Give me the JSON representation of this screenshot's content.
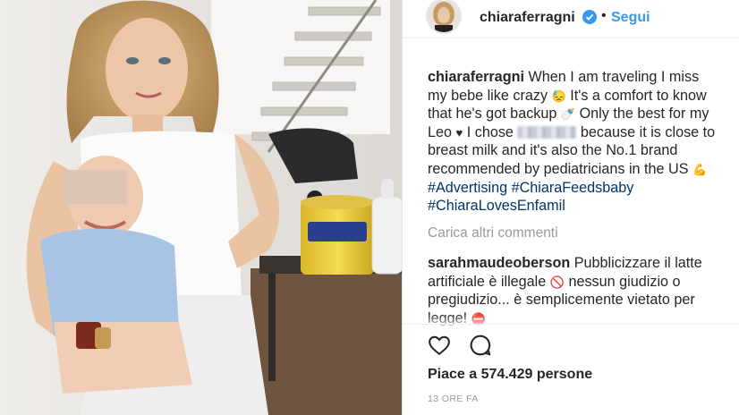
{
  "post": {
    "username": "chiaraferragni",
    "follow_label": "Segui",
    "separator": "•",
    "caption": {
      "username": "chiaraferragni",
      "p1": " When I am traveling I miss my bebe like crazy ",
      "emoji1": "😓",
      "p2": " It's a comfort to know that he's got backup ",
      "emoji2": "🍼",
      "p3": " Only the best for my Leo ",
      "emoji3": "♥",
      "p4": " I chose ",
      "p5": " because it is close to breast milk and it's also the No.1 brand recommended by pediatricians in the US ",
      "emoji4": "💪",
      "tag1": "#Advertising",
      "tag2": "#ChiaraFeedsbaby",
      "tag3": "#ChiaraLovesEnfamil"
    },
    "load_more": "Carica altri commenti",
    "comment": {
      "username": "sarahmaudeoberson",
      "p1": " Pubblicizzare il latte artificiale è illegale ",
      "emoji1": "🚫",
      "p2": " nessun giudizio o pregiudizio... è semplicemente vietato per legge! ",
      "emoji2": "⛔"
    },
    "likes": "Piace a 574.429 persone",
    "time": "13 ORE FA"
  },
  "colors": {
    "link": "#3897f0",
    "hashtag": "#003569",
    "text": "#262626",
    "muted": "#999999"
  },
  "icons": [
    "verified-badge-icon",
    "heart-icon",
    "comment-icon",
    "baby-bottle-icon"
  ]
}
